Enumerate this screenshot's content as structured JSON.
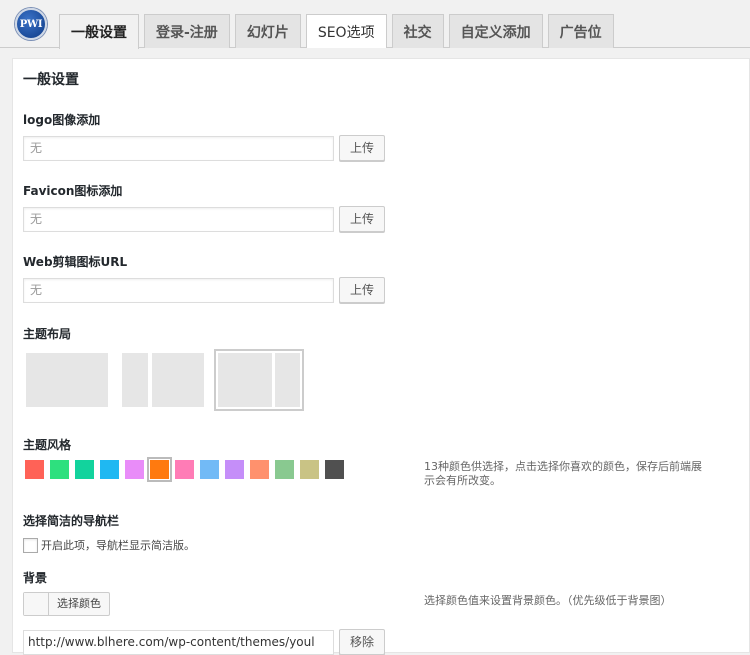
{
  "logo_text": "PWI",
  "tabs": [
    {
      "label": "一般设置"
    },
    {
      "label": "登录-注册"
    },
    {
      "label": "幻灯片"
    },
    {
      "label": "SEO选项"
    },
    {
      "label": "社交"
    },
    {
      "label": "自定义添加"
    },
    {
      "label": "广告位"
    }
  ],
  "general": {
    "title": "一般设置",
    "logo": {
      "label": "logo图像添加",
      "value": "无",
      "button": "上传"
    },
    "favicon": {
      "label": "Favicon图标添加",
      "value": "无",
      "button": "上传"
    },
    "webclip": {
      "label": "Web剪辑图标URL",
      "value": "无",
      "button": "上传"
    },
    "layout": {
      "label": "主题布局",
      "selected_index": 2
    },
    "style": {
      "label": "主题风格",
      "colors": [
        "#ff6257",
        "#2ee07e",
        "#12d39d",
        "#1fb8f2",
        "#e98cf9",
        "#ff7a0f",
        "#ff7cb6",
        "#72baf6",
        "#c58ef9",
        "#ff916d",
        "#89c990",
        "#c9c385",
        "#505050"
      ],
      "selected_index": 5,
      "note": "13种颜色供选择，点击选择你喜欢的颜色，保存后前端展示会有所改变。"
    },
    "simple_nav": {
      "label": "选择简洁的导航栏",
      "checkbox_label": "开启此项，导航栏显示简洁版。",
      "checked": false
    },
    "background": {
      "label": "背景",
      "color_button": "选择颜色",
      "note": "选择颜色值来设置背景颜色。（优先级低于背景图）",
      "url": "http://www.blhere.com/wp-content/themes/youl",
      "remove_button": "移除"
    }
  }
}
